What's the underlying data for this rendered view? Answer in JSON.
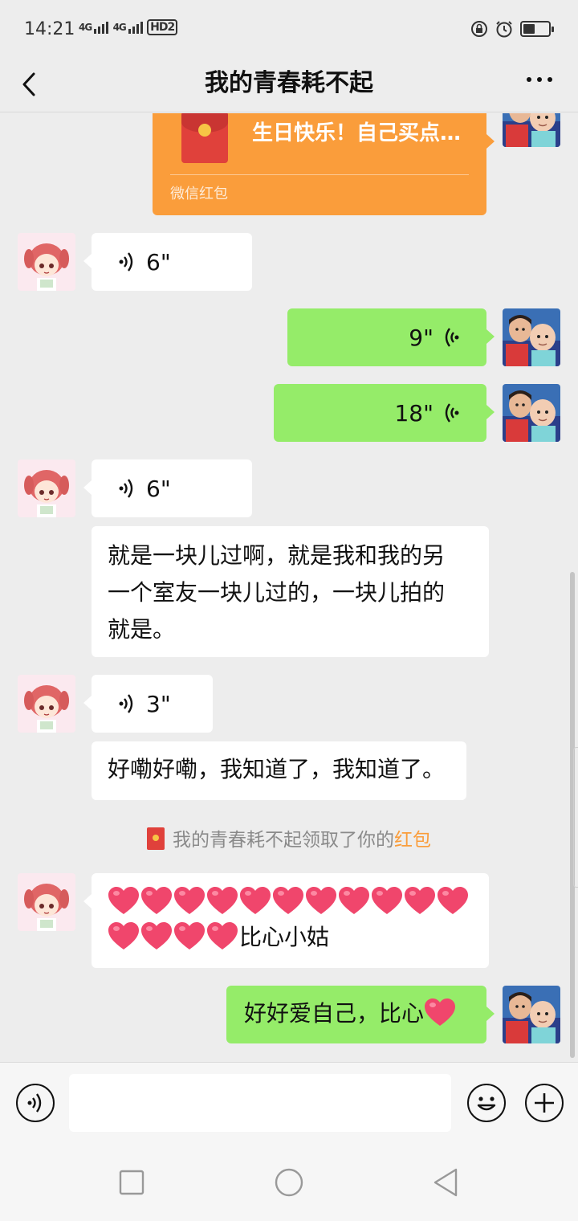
{
  "status_bar": {
    "time": "14:21",
    "signal_1": "4G",
    "signal_2": "4G",
    "hd_label": "HD2",
    "battery_percent": 45,
    "icons": [
      "signal-icon",
      "hd-icon",
      "orientation-lock-icon",
      "alarm-icon",
      "battery-icon"
    ]
  },
  "header": {
    "title": "我的青春耗不起",
    "back_icon": "back-chevron-icon",
    "more_icon": "more-dots-icon"
  },
  "messages": {
    "red_packet": {
      "text": "生日快乐！自己买点…",
      "label": "微信红包"
    },
    "voice_1": {
      "duration": "6\""
    },
    "voice_2": {
      "duration": "9\""
    },
    "voice_3": {
      "duration": "18\""
    },
    "voice_4": {
      "duration": "6\""
    },
    "text_1": {
      "line1": "就是一块儿过啊，就是我和我的另",
      "line2": "一个室友一块儿过的，一块儿拍的",
      "line3": "就是。"
    },
    "voice_5": {
      "duration": "3\""
    },
    "text_2": {
      "text": "好嘞好嘞，我知道了，我知道了。"
    },
    "system_1": {
      "prefix": "我的青春耗不起领取了你的",
      "highlight": "红包"
    },
    "text_3": {
      "line2_suffix": "比心小姑",
      "heart_count_line1": 11,
      "heart_count_line2": 4
    },
    "text_4": {
      "text": "好好爱自己，比心"
    }
  },
  "input_bar": {
    "voice_icon": "voice-input-icon",
    "emoji_icon": "emoji-icon",
    "plus_icon": "plus-icon",
    "placeholder": ""
  },
  "nav_buttons": [
    "recents-icon",
    "home-icon",
    "back-icon"
  ],
  "colors": {
    "background": "#ededed",
    "incoming_bubble": "#ffffff",
    "outgoing_bubble": "#95ec69",
    "red_packet": "#fa9d3b",
    "heart": "#f0466c"
  }
}
